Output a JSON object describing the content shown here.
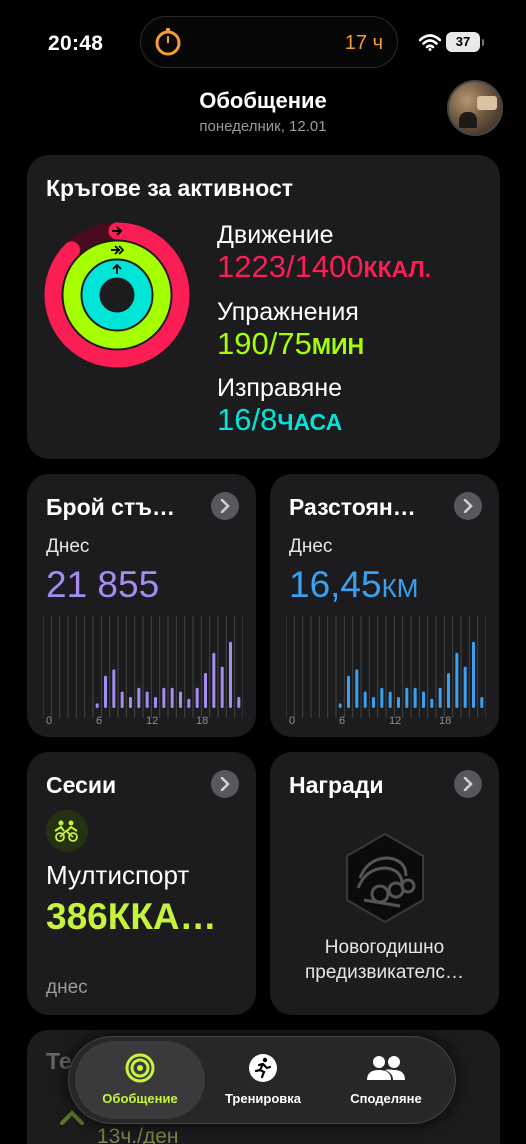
{
  "status": {
    "time": "20:48",
    "timer_text": "17 ч",
    "battery": "37",
    "icons": [
      "timer-icon",
      "wifi-icon",
      "battery-icon"
    ]
  },
  "header": {
    "title": "Обобщение",
    "date": "понеделник, 12.01"
  },
  "activity": {
    "title": "Кръгове за активност",
    "move": {
      "label": "Движение",
      "value": "1223/1400",
      "unit": "ККАЛ.",
      "color": "#fa1e55",
      "progress": 0.874
    },
    "exercise": {
      "label": "Упражнения",
      "value": "190/75",
      "unit": "МИН",
      "color": "#a6ff00",
      "progress": 2.53
    },
    "stand": {
      "label": "Изправяне",
      "value": "16/8",
      "unit": "ЧАСА",
      "color": "#00e5d8",
      "progress": 2.0
    }
  },
  "steps": {
    "title": "Брой стъ…",
    "sublabel": "Днес",
    "value": "21 855",
    "color": "#a48cf0",
    "axis": [
      "0",
      "6",
      "12",
      "18"
    ],
    "chart_data": {
      "type": "bar",
      "x": [
        0,
        1,
        2,
        3,
        4,
        5,
        6,
        7,
        8,
        9,
        10,
        11,
        12,
        13,
        14,
        15,
        16,
        17,
        18,
        19,
        20,
        21,
        22,
        23
      ],
      "values": [
        0,
        0,
        0,
        0,
        0,
        0,
        0.05,
        0.35,
        0.42,
        0.18,
        0.12,
        0.22,
        0.18,
        0.12,
        0.22,
        0.22,
        0.18,
        0.1,
        0.22,
        0.38,
        0.6,
        0.45,
        0.72,
        0.12
      ],
      "xlabel": "",
      "ylabel": ""
    }
  },
  "distance": {
    "title": "Разстоян…",
    "sublabel": "Днес",
    "value": "16,45",
    "unit": "КМ",
    "color": "#3aa0f0",
    "axis": [
      "0",
      "6",
      "12",
      "18"
    ],
    "chart_data": {
      "type": "bar",
      "x": [
        0,
        1,
        2,
        3,
        4,
        5,
        6,
        7,
        8,
        9,
        10,
        11,
        12,
        13,
        14,
        15,
        16,
        17,
        18,
        19,
        20,
        21,
        22,
        23
      ],
      "values": [
        0,
        0,
        0,
        0,
        0,
        0,
        0.05,
        0.35,
        0.42,
        0.18,
        0.12,
        0.22,
        0.18,
        0.12,
        0.22,
        0.22,
        0.18,
        0.1,
        0.22,
        0.38,
        0.6,
        0.45,
        0.72,
        0.12
      ],
      "xlabel": "",
      "ylabel": ""
    }
  },
  "sessions": {
    "title": "Сесии",
    "workout": "Мултиспорт",
    "value": "386ККА…",
    "time": "днес",
    "color": "#c6f43c",
    "icon": "multisport-icon"
  },
  "awards": {
    "title": "Награди",
    "line1": "Новогодишно",
    "line2": "предизвикателс…",
    "icon": "award-badge-icon"
  },
  "peek": {
    "title": "Те",
    "sub": "13ч./ден"
  },
  "tabbar": {
    "tabs": [
      {
        "label": "Обобщение",
        "icon": "rings-icon",
        "active": true
      },
      {
        "label": "Тренировка",
        "icon": "runner-icon",
        "active": false
      },
      {
        "label": "Споделяне",
        "icon": "people-icon",
        "active": false
      }
    ],
    "accent": "#c6f43c"
  }
}
